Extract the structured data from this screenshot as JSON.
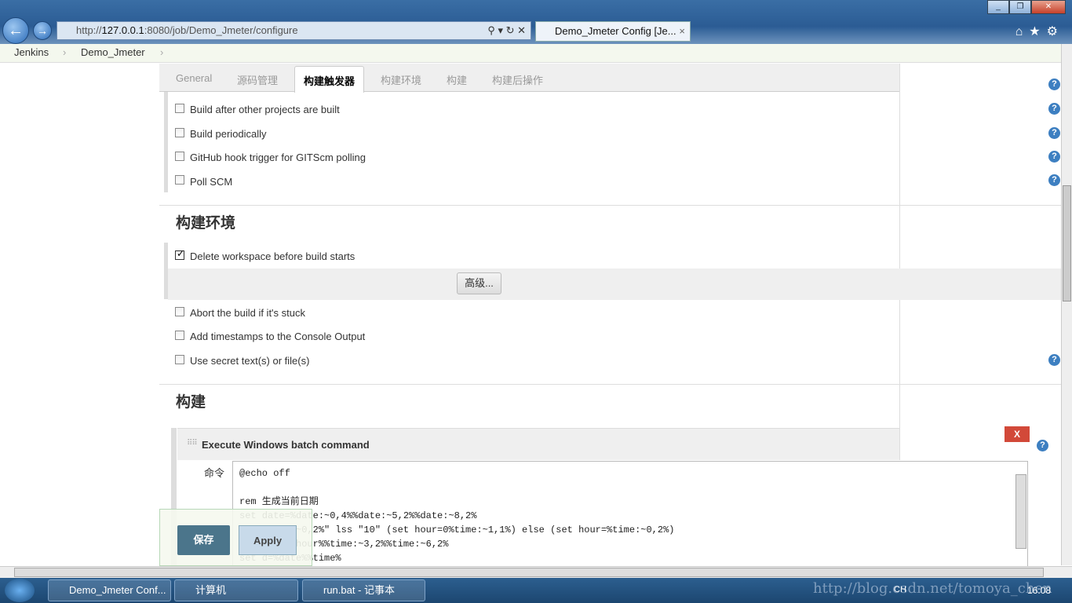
{
  "browser": {
    "url_prefix": "http://",
    "url_host": "127.0.0.1",
    "url_rest": ":8080/job/Demo_Jmeter/configure",
    "tab_title": "Demo_Jmeter Config [Je...",
    "tab_close": "×",
    "back": "←",
    "forward": "→",
    "toolbar_icons": "⌂★⚙",
    "search_icons": "⚲ ▾ ↻ ✕"
  },
  "breadcrumb": {
    "items": [
      "Jenkins",
      "Demo_Jmeter"
    ],
    "sep": "›"
  },
  "tabs": [
    "General",
    "源码管理",
    "构建触发器",
    "构建环境",
    "构建",
    "构建后操作"
  ],
  "active_tab": 2,
  "triggers": [
    {
      "label": "Build after other projects are built",
      "checked": false
    },
    {
      "label": "Build periodically",
      "checked": false
    },
    {
      "label": "GitHub hook trigger for GITScm polling",
      "checked": false
    },
    {
      "label": "Poll SCM",
      "checked": false
    }
  ],
  "build_env": {
    "title": "构建环境",
    "options": [
      {
        "label": "Delete workspace before build starts",
        "checked": true
      },
      {
        "label": "Abort the build if it's stuck",
        "checked": false
      },
      {
        "label": "Add timestamps to the Console Output",
        "checked": false
      },
      {
        "label": "Use secret text(s) or file(s)",
        "checked": false
      }
    ],
    "advanced": "高级..."
  },
  "build": {
    "title": "构建",
    "step_title": "Execute Windows batch command",
    "delete": "X",
    "command_label": "命令",
    "command": "@echo off\n\nrem 生成当前日期\nset date=%date:~0,4%%date:~5,2%%date:~8,2%\nif \"%time:~0,2%\" lss \"10\" (set hour=0%time:~1,1%) else (set hour=%time:~0,2%)\nset time=%hour%%time:~3,2%%time:~6,2%\nset d=%date%%time%"
  },
  "actions": {
    "save": "保存",
    "apply": "Apply"
  },
  "help": "?",
  "taskbar": {
    "items": [
      "Demo_Jmeter Conf...",
      "计算机",
      "run.bat - 记事本"
    ],
    "lang": "CH",
    "clock": "16:08",
    "watermark": "http://blog.csdn.net/tomoya_chen"
  }
}
